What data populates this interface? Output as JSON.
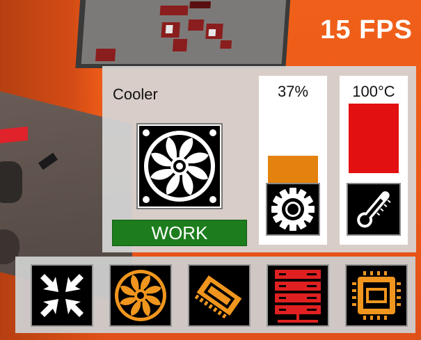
{
  "hud": {
    "fps": "15 FPS"
  },
  "panel": {
    "title": "Cooler",
    "status_button": "WORK",
    "status_color": "#1d7d1d",
    "main_icon": "fan-icon",
    "power": {
      "label": "37%",
      "level": 0.37,
      "color": "#e3820f",
      "icon": "gear-icon"
    },
    "temperature": {
      "label": "100°C",
      "level": 1.0,
      "color": "#e21010",
      "icon": "thermometer-icon"
    }
  },
  "toolbar": {
    "items": [
      {
        "icon": "collapse-icon",
        "color": "#ffffff"
      },
      {
        "icon": "fan-icon",
        "color": "#f0961e"
      },
      {
        "icon": "memory-chip-icon",
        "color": "#f0961e"
      },
      {
        "icon": "server-rack-icon",
        "color": "#e02020"
      },
      {
        "icon": "cpu-icon",
        "color": "#f0961e"
      }
    ]
  }
}
